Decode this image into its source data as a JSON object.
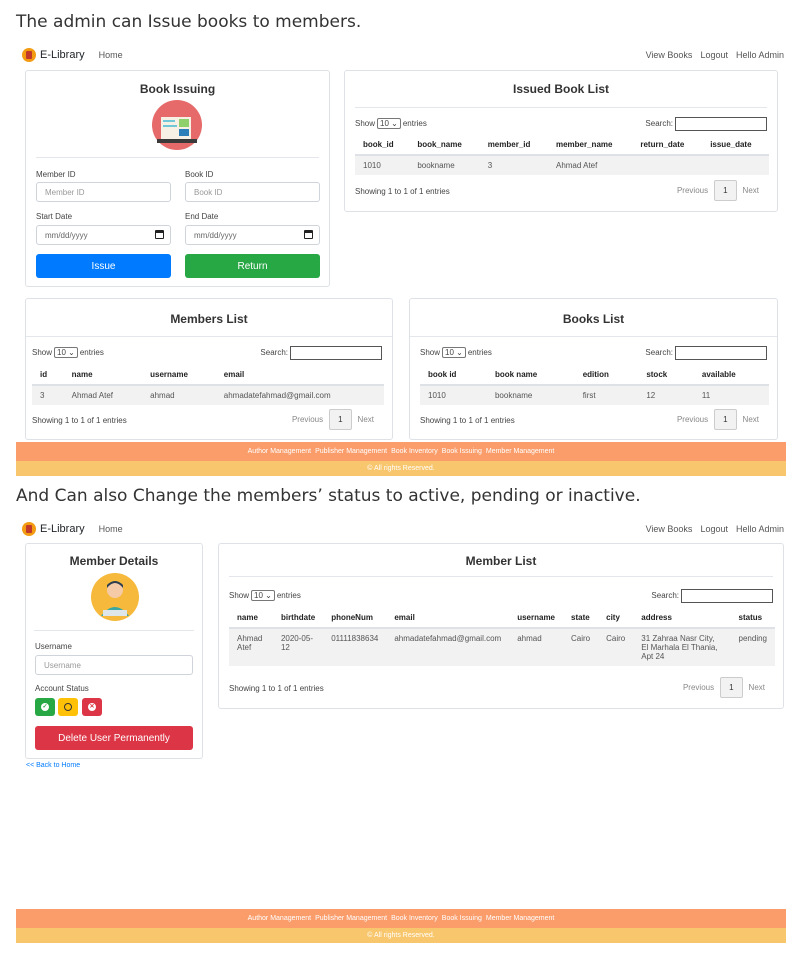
{
  "captions": {
    "first": "The admin can Issue books to members.",
    "second": "And Can also Change the members’ status to active, pending or inactive."
  },
  "nav": {
    "brand": "E-Library",
    "home": "Home",
    "view_books": "View Books",
    "logout": "Logout",
    "hello": "Hello Admin"
  },
  "issuing": {
    "title": "Book Issuing",
    "member_id_label": "Member ID",
    "member_id_placeholder": "Member ID",
    "book_id_label": "Book ID",
    "book_id_placeholder": "Book ID",
    "start_label": "Start Date",
    "start_placeholder": "mm/dd/yyyy",
    "end_label": "End Date",
    "end_placeholder": "mm/dd/yyyy",
    "issue_button": "Issue",
    "return_button": "Return"
  },
  "common": {
    "show": "Show",
    "entries_value": "10",
    "entries": "entries",
    "search": "Search:",
    "showing": "Showing 1 to 1 of 1 entries",
    "previous": "Previous",
    "page": "1",
    "next": "Next"
  },
  "issued": {
    "title": "Issued Book List",
    "headers": [
      "book_id",
      "book_name",
      "member_id",
      "member_name",
      "return_date",
      "issue_date"
    ],
    "row": [
      "1010",
      "bookname",
      "3",
      "Ahmad Atef",
      "",
      ""
    ]
  },
  "members": {
    "title": "Members List",
    "headers": [
      "id",
      "name",
      "username",
      "email"
    ],
    "row": [
      "3",
      "Ahmad Atef",
      "ahmad",
      "ahmadatefahmad@gmail.com"
    ]
  },
  "books": {
    "title": "Books List",
    "headers": [
      "book id",
      "book name",
      "edition",
      "stock",
      "available"
    ],
    "row": [
      "1010",
      "bookname",
      "first",
      "12",
      "11"
    ]
  },
  "footer": {
    "links": [
      "Author Management",
      "Publisher Management",
      "Book Inventory",
      "Book Issuing",
      "Member Management"
    ],
    "copyright": "© All rights Reserved."
  },
  "member_details": {
    "title": "Member Details",
    "username_label": "Username",
    "username_placeholder": "Username",
    "status_label": "Account Status",
    "delete_button": "Delete User Permanently",
    "back_link": "<< Back to Home"
  },
  "member_list": {
    "title": "Member List",
    "headers": [
      "name",
      "birthdate",
      "phoneNum",
      "email",
      "username",
      "state",
      "city",
      "address",
      "status"
    ],
    "row": [
      "Ahmad Atef",
      "2020-05-12",
      "01111838634",
      "ahmadatefahmad@gmail.com",
      "ahmad",
      "Cairo",
      "Cairo",
      "31 Zahraa Nasr City, El Marhala El Thania, Apt 24",
      "pending"
    ]
  },
  "colors": {
    "primary": "#007bff",
    "success": "#28a745",
    "danger": "#dc3545",
    "warning": "#ffc107",
    "footer_top": "#fa9d6b",
    "footer_bottom": "#f8c66c"
  }
}
